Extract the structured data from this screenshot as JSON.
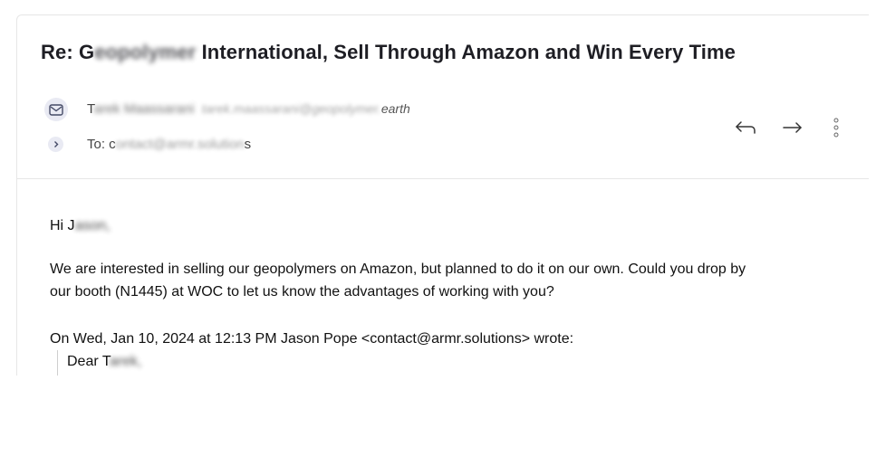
{
  "email": {
    "subject_prefix": "Re: G",
    "subject_redacted": "eopolymer",
    "subject_rest": " International, Sell Through Amazon and Win Every Time",
    "from": {
      "initial": "T",
      "name_redacted": "arek Maassarani",
      "address_redacted": "tarek.maassarani@geopolymer.",
      "address_suffix": "earth"
    },
    "to": {
      "label": "To: c",
      "address_redacted": "ontact@armr.solution",
      "address_suffix": "s"
    },
    "body": {
      "greeting_prefix": "Hi J",
      "greeting_redacted": "ason,",
      "paragraph_line1": "We are interested in selling our geopolymers on Amazon, but planned to do it on our own. Could you drop by",
      "paragraph_line2": "our booth (N1445) at WOC to let us know the advantages of working with you?",
      "quote_header": "On Wed, Jan 10, 2024 at 12:13 PM Jason Pope <contact@armr.solutions> wrote:",
      "quote_salutation_prefix": "Dear T",
      "quote_salutation_redacted": "arek,"
    }
  },
  "icons": {
    "from_icon": "mail-icon",
    "to_icon": "chevron-right-icon",
    "reply_icon": "reply-icon",
    "forward_icon": "forward-icon",
    "more_icon": "more-vertical-icon"
  },
  "colors": {
    "icon_bg": "#e9eaf3",
    "divider": "#e6e6e6",
    "subject_text": "#1e1e24"
  }
}
